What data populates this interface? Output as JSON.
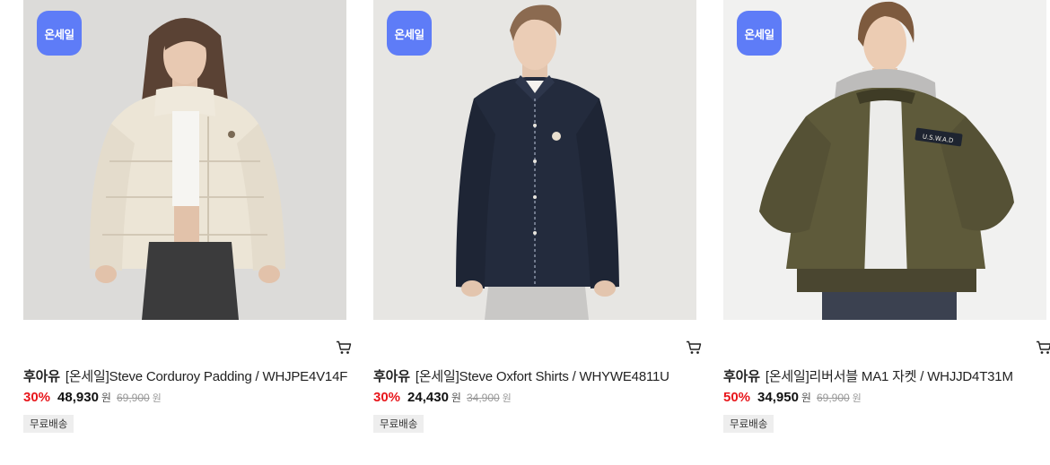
{
  "products": [
    {
      "badge": "온세일",
      "brand": "후아유",
      "name": "[온세일]Steve Corduroy Padding / WHJPE4V14F",
      "discount": "30%",
      "price": "48,930",
      "currency": "원",
      "original_price": "69,900",
      "original_currency": "원",
      "tag": "무료배송",
      "image": "woman-cream-corduroy-padding-jacket"
    },
    {
      "badge": "온세일",
      "brand": "후아유",
      "name": "[온세일]Steve Oxfort Shirts / WHYWE4811U",
      "discount": "30%",
      "price": "24,430",
      "currency": "원",
      "original_price": "34,900",
      "original_currency": "원",
      "tag": "무료배송",
      "image": "man-navy-oxford-shirt"
    },
    {
      "badge": "온세일",
      "brand": "후아유",
      "name": "[온세일]리버서블 MA1 자켓 / WHJJD4T31M",
      "discount": "50%",
      "price": "34,950",
      "currency": "원",
      "original_price": "69,900",
      "original_currency": "원",
      "tag": "무료배송",
      "image": "man-khaki-ma1-bomber-jacket",
      "patch_text": "U.S.W.A.D"
    }
  ],
  "colors": {
    "badge": "#5e7cf7",
    "discount": "#e8161b",
    "tag_bg": "#eeeeee"
  },
  "icons": {
    "cart": "cart-icon"
  }
}
